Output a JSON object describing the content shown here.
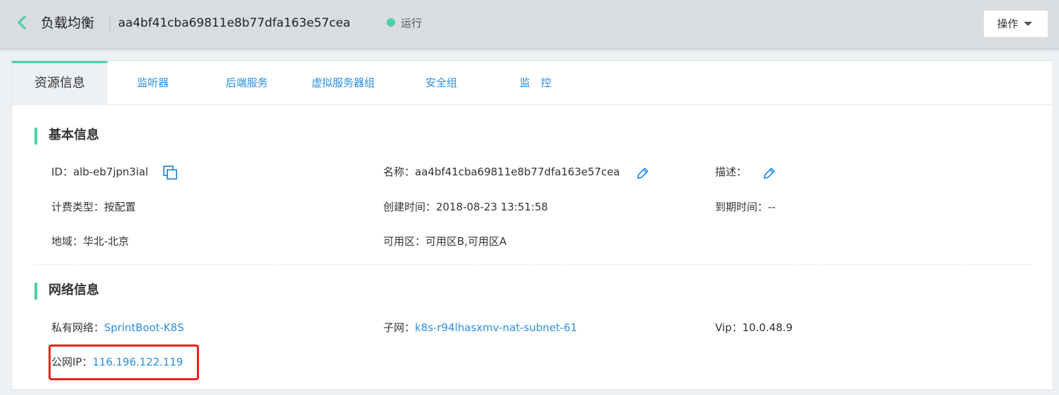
{
  "header": {
    "title": "负载均衡",
    "lb_id": "aa4bf41cba69811e8b77dfa163e57cea",
    "status": "运行",
    "status_color": "#4ecfa8",
    "ops_label": "操作"
  },
  "tabs": [
    {
      "label": "资源信息",
      "active": true
    },
    {
      "label": "监听器"
    },
    {
      "label": "后端服务"
    },
    {
      "label": "虚拟服务器组"
    },
    {
      "label": "安全组"
    },
    {
      "label": "监　控"
    }
  ],
  "basic": {
    "title": "基本信息",
    "id_label": "ID：",
    "id_value": "alb-eb7jpn3ial",
    "name_label": "名称：",
    "name_value": "aa4bf41cba69811e8b77dfa163e57cea",
    "desc_label": "描述：",
    "billing_label": "计费类型：",
    "billing_value": "按配置",
    "created_label": "创建时间：",
    "created_value": "2018-08-23 13:51:58",
    "expire_label": "到期时间：",
    "expire_value": "--",
    "region_label": "地域：",
    "region_value": "华北-北京",
    "az_label": "可用区：",
    "az_value": "可用区B,可用区A"
  },
  "network": {
    "title": "网络信息",
    "vpc_label": "私有网络：",
    "vpc_value": "SprintBoot-K8S",
    "subnet_label": "子网：",
    "subnet_value": "k8s-r94lhasxmv-nat-subnet-61",
    "vip_label": "Vip：",
    "vip_value": "10.0.48.9",
    "public_ip_label": "公网IP：",
    "public_ip_value": "116.196.122.119"
  },
  "colors": {
    "accent": "#4ecfa8",
    "link": "#2a8fe0",
    "highlight": "#e8231d"
  },
  "icons": {
    "back": "chevron-left-icon",
    "copy": "copy-icon",
    "edit": "pencil-icon",
    "dropdown": "caret-down-icon"
  }
}
